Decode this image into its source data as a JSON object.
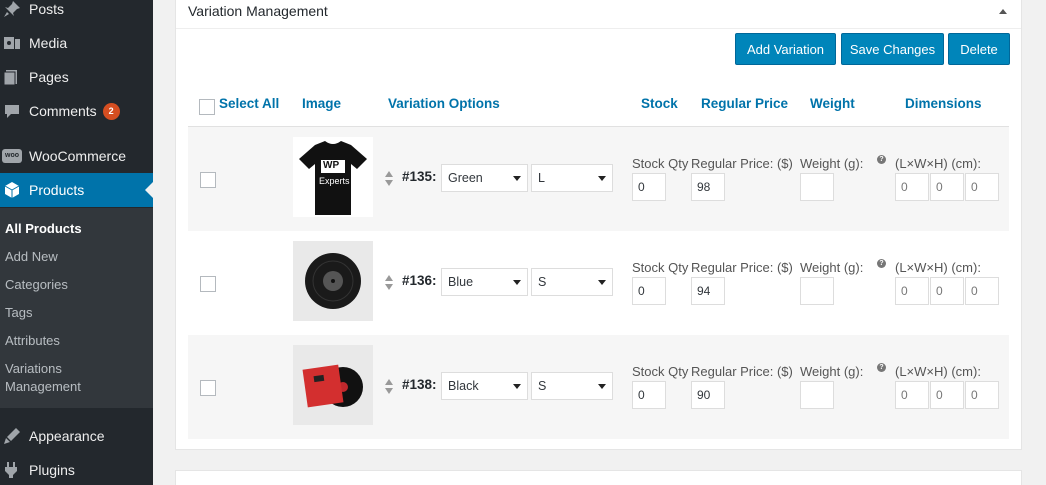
{
  "sidebar": {
    "top_items": [
      {
        "label": "Posts",
        "icon": "pin-icon"
      },
      {
        "label": "Media",
        "icon": "media-icon"
      },
      {
        "label": "Pages",
        "icon": "pages-icon"
      },
      {
        "label": "Comments",
        "icon": "comments-icon",
        "badge": "2"
      },
      {
        "label": "WooCommerce",
        "icon": "woocommerce-icon"
      },
      {
        "label": "Products",
        "icon": "products-icon"
      }
    ],
    "submenu": [
      "All Products",
      "Add New",
      "Categories",
      "Tags",
      "Attributes",
      "Variations",
      "Management"
    ],
    "bottom_items": [
      {
        "label": "Appearance",
        "icon": "appearance-icon"
      },
      {
        "label": "Plugins",
        "icon": "plugins-icon"
      }
    ],
    "woo_icon_text": "woo"
  },
  "panel": {
    "title": "Variation Management",
    "buttons": {
      "add": "Add Variation",
      "save": "Save Changes",
      "delete": "Delete"
    },
    "columns": {
      "select_all": "Select All",
      "image": "Image",
      "options": "Variation Options",
      "stock": "Stock",
      "price": "Regular Price",
      "weight": "Weight",
      "dimensions": "Dimensions"
    },
    "labels": {
      "stock_qty": "Stock Qty",
      "regular_price": "Regular Price: ($)",
      "weight": "Weight (g):",
      "dimensions": "(L×W×H) (cm):",
      "help": "?"
    },
    "rows": [
      {
        "id": "#135:",
        "color": "Green",
        "size": "L",
        "stock": "0",
        "price": "98",
        "weight": "",
        "dims": [
          "0",
          "0",
          "0"
        ],
        "image": "tshirt"
      },
      {
        "id": "#136:",
        "color": "Blue",
        "size": "S",
        "stock": "0",
        "price": "94",
        "weight": "",
        "dims": [
          "0",
          "0",
          "0"
        ],
        "image": "vinyl"
      },
      {
        "id": "#138:",
        "color": "Black",
        "size": "S",
        "stock": "0",
        "price": "90",
        "weight": "",
        "dims": [
          "0",
          "0",
          "0"
        ],
        "image": "album"
      }
    ],
    "tshirt_logo": {
      "line1": "WP",
      "line2": "Experts"
    }
  },
  "colors": {
    "accent": "#0073aa",
    "button": "#0085ba",
    "sidebar": "#23282d",
    "badge": "#d54e21"
  }
}
